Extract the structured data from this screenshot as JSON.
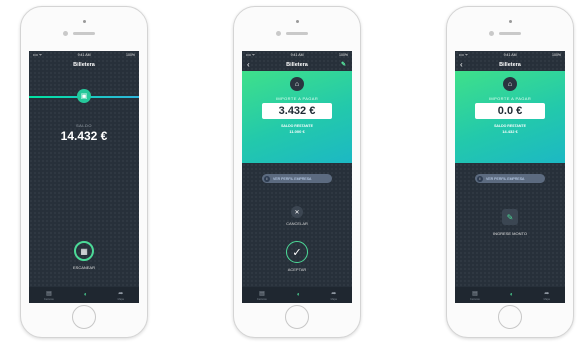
{
  "status": {
    "carrier": "•••• ᯤ",
    "time": "9:41 AM",
    "battery": "100%"
  },
  "nav": {
    "title": "Billetera"
  },
  "screen1": {
    "saldo_label": "SALDO",
    "saldo_value": "14.432 €",
    "scan_label": "ESCANEAR"
  },
  "screen2": {
    "importe_label": "IMPORTE A PAGAR",
    "amount": "3.432 €",
    "restante_label": "SALDO RESTANTE",
    "restante_value": "11.000 €",
    "perfil_label": "VER PERFIL EMPRESA",
    "cancel_label": "CANCELAR",
    "accept_label": "ACEPTAR"
  },
  "screen3": {
    "importe_label": "IMPORTE A PAGAR",
    "amount": "0.0 €",
    "restante_label": "SALDO RESTANTE",
    "restante_value": "14.432 €",
    "perfil_label": "VER PERFIL EMPRESA",
    "ingrese_label": "INGRESE MONTO"
  },
  "tabs": [
    {
      "icon": "receipt-icon",
      "label": "Facturas"
    },
    {
      "icon": "wallet-icon",
      "label": ""
    },
    {
      "icon": "compass-icon",
      "label": "Mapa"
    }
  ],
  "colors": {
    "accent": "#4cd997",
    "screen_bg": "#27303a",
    "gradient_start": "#3fe08a",
    "gradient_end": "#1cb8c4"
  }
}
